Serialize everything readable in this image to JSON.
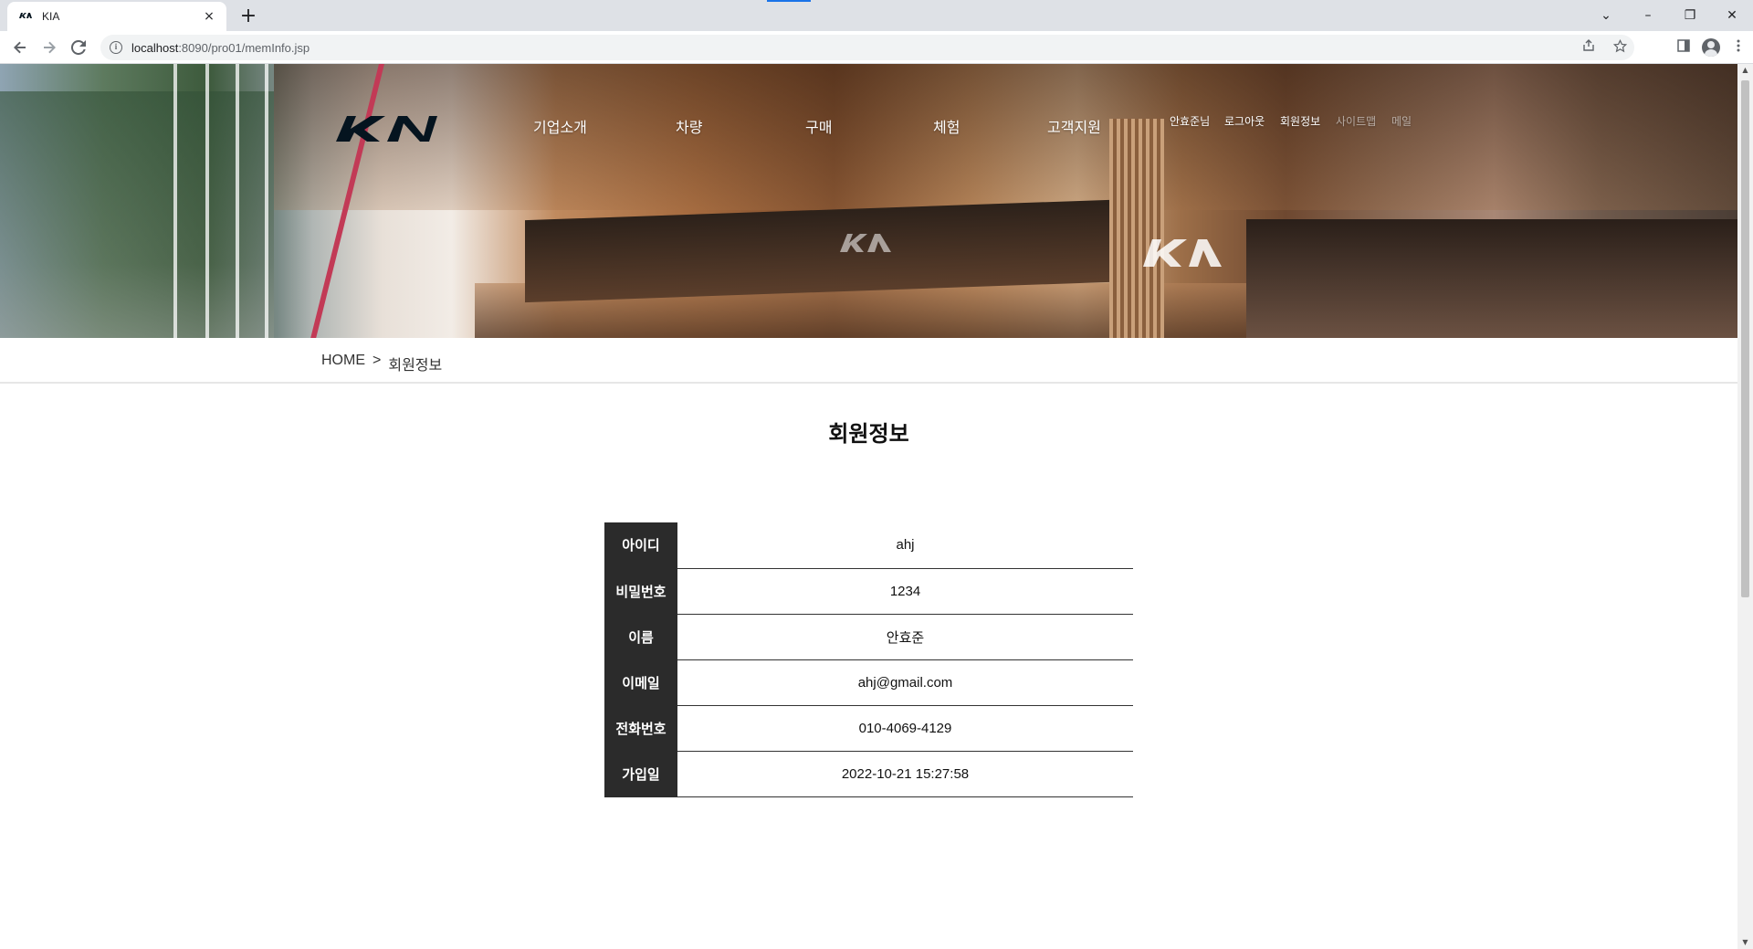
{
  "browser": {
    "tab_title": "KIA",
    "tab_close": "×",
    "new_tab": "+",
    "url_host": "localhost",
    "url_path": ":8090/pro01/memInfo.jsp",
    "icons": [
      "back-arrow-icon",
      "forward-arrow-icon",
      "reload-icon",
      "info-icon",
      "share-icon",
      "star-icon",
      "side-panel-icon",
      "profile-icon",
      "kebab-menu-icon"
    ]
  },
  "window": {
    "tab_search": "⌄",
    "minimize": "–",
    "restore": "❐",
    "close": "✕"
  },
  "header": {
    "logo_text": "KIA",
    "nav": [
      "기업소개",
      "차량",
      "구매",
      "체험",
      "고객지원"
    ],
    "util": [
      "안효준님",
      "로그아웃",
      "회원정보",
      "사이트맵",
      "메일"
    ]
  },
  "breadcrumb": {
    "home": "HOME",
    "separator": ">",
    "current": "회원정보"
  },
  "main": {
    "title": "회원정보",
    "rows": [
      {
        "label": "아이디",
        "value": "ahj"
      },
      {
        "label": "비밀번호",
        "value": "1234"
      },
      {
        "label": "이름",
        "value": "안효준"
      },
      {
        "label": "이메일",
        "value": "ahj@gmail.com"
      },
      {
        "label": "전화번호",
        "value": "010-4069-4129"
      },
      {
        "label": "가입일",
        "value": "2022-10-21 15:27:58"
      }
    ]
  },
  "colors": {
    "table_header_bg": "#2b2b2b",
    "accent_tab_progress": "#1a73e8"
  }
}
